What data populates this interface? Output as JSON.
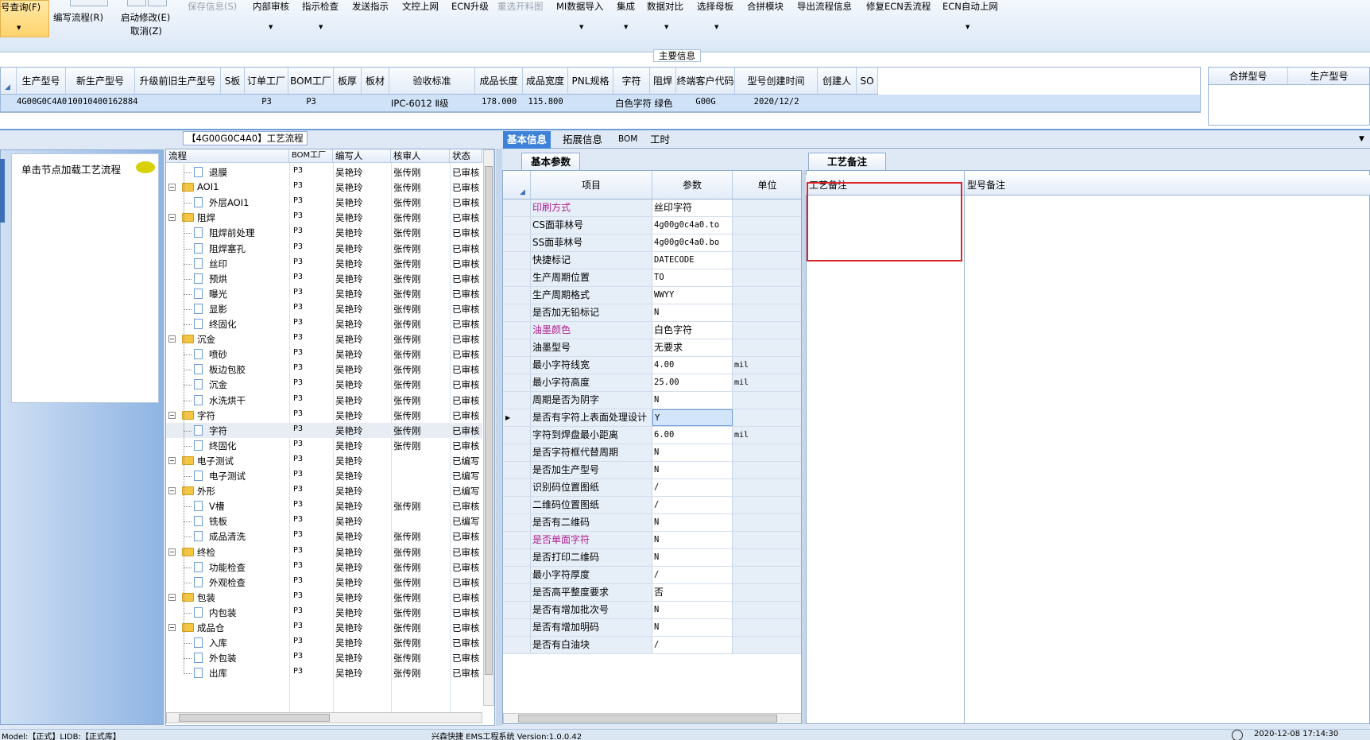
{
  "toolbar": {
    "query": "号查询(F)",
    "write_flow": "编写流程(R)",
    "start_modify": "启动修改(E)",
    "cancel": "取消(Z)",
    "save_info": "保存信息(S)",
    "internal_review": "内部审核",
    "guide_check": "指示检查",
    "send_guide": "发送指示",
    "doc_upload": "文控上网",
    "ecn_upgrade": "ECN升级",
    "resend_cut": "重选开料图",
    "mi_import": "MI数据导入",
    "integrate": "集成",
    "data_compare": "数据对比",
    "select_master": "选择母板",
    "merge_module": "合拼模块",
    "export_flow": "导出流程信息",
    "fix_ecn": "修复ECN丢流程",
    "ecn_auto": "ECN自动上网"
  },
  "main_info_label": "主要信息",
  "main_grid": {
    "headers": [
      "生产型号",
      "新生产型号",
      "升级前旧生产型号",
      "S板",
      "订单工厂",
      "BOM工厂",
      "板厚",
      "板材",
      "验收标准",
      "成品长度",
      "成品宽度",
      "PNL规格",
      "字符",
      "阻焊",
      "终端客户代码",
      "型号创建时间",
      "创建人",
      "SO"
    ],
    "row": [
      "4G00G0C4A0",
      "10010400162884",
      "",
      "",
      "P3",
      "P3",
      "",
      "",
      "IPC-6012 Ⅱ级",
      "178.000",
      "115.800",
      "",
      "白色字符",
      "绿色",
      "G00G",
      "2020/12/2",
      "",
      ""
    ]
  },
  "right_grid": {
    "headers": [
      "合拼型号",
      "生产型号"
    ]
  },
  "left_panel": {
    "load_hint": "单击节点加载工艺流程"
  },
  "tree_tab": "【4G00G0C4A0】工艺流程",
  "tree": {
    "headers": [
      "流程",
      "BOM工厂",
      "编写人",
      "核审人",
      "状态"
    ],
    "rows": [
      {
        "name": "退膜",
        "level": 2,
        "bom": "P3",
        "writer": "吴艳玲",
        "reviewer": "张传刚",
        "status": "已审核"
      },
      {
        "name": "AOI1",
        "level": 1,
        "bom": "P3",
        "writer": "吴艳玲",
        "reviewer": "张传刚",
        "status": "已审核"
      },
      {
        "name": "外层AOI1",
        "level": 2,
        "bom": "P3",
        "writer": "吴艳玲",
        "reviewer": "张传刚",
        "status": "已审核"
      },
      {
        "name": "阻焊",
        "level": 1,
        "bom": "P3",
        "writer": "吴艳玲",
        "reviewer": "张传刚",
        "status": "已审核"
      },
      {
        "name": "阻焊前处理",
        "level": 2,
        "bom": "P3",
        "writer": "吴艳玲",
        "reviewer": "张传刚",
        "status": "已审核"
      },
      {
        "name": "阻焊塞孔",
        "level": 2,
        "bom": "P3",
        "writer": "吴艳玲",
        "reviewer": "张传刚",
        "status": "已审核"
      },
      {
        "name": "丝印",
        "level": 2,
        "bom": "P3",
        "writer": "吴艳玲",
        "reviewer": "张传刚",
        "status": "已审核"
      },
      {
        "name": "预烘",
        "level": 2,
        "bom": "P3",
        "writer": "吴艳玲",
        "reviewer": "张传刚",
        "status": "已审核"
      },
      {
        "name": "曝光",
        "level": 2,
        "bom": "P3",
        "writer": "吴艳玲",
        "reviewer": "张传刚",
        "status": "已审核"
      },
      {
        "name": "显影",
        "level": 2,
        "bom": "P3",
        "writer": "吴艳玲",
        "reviewer": "张传刚",
        "status": "已审核"
      },
      {
        "name": "终固化",
        "level": 2,
        "bom": "P3",
        "writer": "吴艳玲",
        "reviewer": "张传刚",
        "status": "已审核"
      },
      {
        "name": "沉金",
        "level": 1,
        "bom": "P3",
        "writer": "吴艳玲",
        "reviewer": "张传刚",
        "status": "已审核"
      },
      {
        "name": "喷砂",
        "level": 2,
        "bom": "P3",
        "writer": "吴艳玲",
        "reviewer": "张传刚",
        "status": "已审核"
      },
      {
        "name": "板边包胶",
        "level": 2,
        "bom": "P3",
        "writer": "吴艳玲",
        "reviewer": "张传刚",
        "status": "已审核"
      },
      {
        "name": "沉金",
        "level": 2,
        "bom": "P3",
        "writer": "吴艳玲",
        "reviewer": "张传刚",
        "status": "已审核"
      },
      {
        "name": "水洗烘干",
        "level": 2,
        "bom": "P3",
        "writer": "吴艳玲",
        "reviewer": "张传刚",
        "status": "已审核"
      },
      {
        "name": "字符",
        "level": 1,
        "bom": "P3",
        "writer": "吴艳玲",
        "reviewer": "张传刚",
        "status": "已审核"
      },
      {
        "name": "字符",
        "level": 2,
        "bom": "P3",
        "writer": "吴艳玲",
        "reviewer": "张传刚",
        "status": "已审核",
        "selected": true
      },
      {
        "name": "终固化",
        "level": 2,
        "bom": "P3",
        "writer": "吴艳玲",
        "reviewer": "张传刚",
        "status": "已审核"
      },
      {
        "name": "电子测试",
        "level": 1,
        "bom": "P3",
        "writer": "吴艳玲",
        "reviewer": "",
        "status": "已编写"
      },
      {
        "name": "电子测试",
        "level": 2,
        "bom": "P3",
        "writer": "吴艳玲",
        "reviewer": "",
        "status": "已编写"
      },
      {
        "name": "外形",
        "level": 1,
        "bom": "P3",
        "writer": "吴艳玲",
        "reviewer": "",
        "status": "已编写"
      },
      {
        "name": "V槽",
        "level": 2,
        "bom": "P3",
        "writer": "吴艳玲",
        "reviewer": "张传刚",
        "status": "已审核"
      },
      {
        "name": "铣板",
        "level": 2,
        "bom": "P3",
        "writer": "吴艳玲",
        "reviewer": "",
        "status": "已编写"
      },
      {
        "name": "成品清洗",
        "level": 2,
        "bom": "P3",
        "writer": "吴艳玲",
        "reviewer": "张传刚",
        "status": "已审核"
      },
      {
        "name": "终检",
        "level": 1,
        "bom": "P3",
        "writer": "吴艳玲",
        "reviewer": "张传刚",
        "status": "已审核"
      },
      {
        "name": "功能检查",
        "level": 2,
        "bom": "P3",
        "writer": "吴艳玲",
        "reviewer": "张传刚",
        "status": "已审核"
      },
      {
        "name": "外观检查",
        "level": 2,
        "bom": "P3",
        "writer": "吴艳玲",
        "reviewer": "张传刚",
        "status": "已审核"
      },
      {
        "name": "包装",
        "level": 1,
        "bom": "P3",
        "writer": "吴艳玲",
        "reviewer": "张传刚",
        "status": "已审核"
      },
      {
        "name": "内包装",
        "level": 2,
        "bom": "P3",
        "writer": "吴艳玲",
        "reviewer": "张传刚",
        "status": "已审核"
      },
      {
        "name": "成品仓",
        "level": 1,
        "bom": "P3",
        "writer": "吴艳玲",
        "reviewer": "张传刚",
        "status": "已审核"
      },
      {
        "name": "入库",
        "level": 2,
        "bom": "P3",
        "writer": "吴艳玲",
        "reviewer": "张传刚",
        "status": "已审核"
      },
      {
        "name": "外包装",
        "level": 2,
        "bom": "P3",
        "writer": "吴艳玲",
        "reviewer": "张传刚",
        "status": "已审核"
      },
      {
        "name": "出库",
        "level": 2,
        "bom": "P3",
        "writer": "吴艳玲",
        "reviewer": "张传刚",
        "status": "已审核"
      }
    ]
  },
  "mid_tabs": [
    "基本信息",
    "拓展信息",
    "BOM",
    "工时"
  ],
  "param_tab": "基本参数",
  "param_grid": {
    "headers": [
      "项目",
      "参数",
      "单位"
    ],
    "rows": [
      {
        "item": "印刷方式",
        "value": "丝印字符",
        "unit": "",
        "mag": true,
        "cn": true
      },
      {
        "item": "CS面菲林号",
        "value": "4g00g0c4a0.to",
        "unit": ""
      },
      {
        "item": "SS面菲林号",
        "value": "4g00g0c4a0.bo",
        "unit": ""
      },
      {
        "item": "快捷标记",
        "value": "DATECODE",
        "unit": ""
      },
      {
        "item": "生产周期位置",
        "value": "TO",
        "unit": ""
      },
      {
        "item": "生产周期格式",
        "value": "WWYY",
        "unit": ""
      },
      {
        "item": "是否加无铅标记",
        "value": "N",
        "unit": ""
      },
      {
        "item": "油墨颜色",
        "value": "白色字符",
        "unit": "",
        "mag": true,
        "cn": true
      },
      {
        "item": "油墨型号",
        "value": "无要求",
        "unit": "",
        "cn": true
      },
      {
        "item": "最小字符线宽",
        "value": "4.00",
        "unit": "mil"
      },
      {
        "item": "最小字符高度",
        "value": "25.00",
        "unit": "mil"
      },
      {
        "item": "周期是否为阴字",
        "value": "N",
        "unit": ""
      },
      {
        "item": "是否有字符上表面处理设计",
        "value": "Y",
        "unit": "",
        "current": true
      },
      {
        "item": "字符到焊盘最小距离",
        "value": "6.00",
        "unit": "mil"
      },
      {
        "item": "是否字符框代替周期",
        "value": "N",
        "unit": ""
      },
      {
        "item": "是否加生产型号",
        "value": "N",
        "unit": ""
      },
      {
        "item": "识别码位置图纸",
        "value": "/",
        "unit": ""
      },
      {
        "item": "二维码位置图纸",
        "value": "/",
        "unit": ""
      },
      {
        "item": "是否有二维码",
        "value": "N",
        "unit": ""
      },
      {
        "item": "是否单面字符",
        "value": "N",
        "unit": "",
        "mag": true
      },
      {
        "item": "是否打印二维码",
        "value": "N",
        "unit": ""
      },
      {
        "item": "最小字符厚度",
        "value": "/",
        "unit": ""
      },
      {
        "item": "是否高平整度要求",
        "value": "否",
        "unit": "",
        "cn": true
      },
      {
        "item": "是否有增加批次号",
        "value": "N",
        "unit": ""
      },
      {
        "item": "是否有增加明码",
        "value": "N",
        "unit": ""
      },
      {
        "item": "是否有白油块",
        "value": "/",
        "unit": ""
      }
    ]
  },
  "remark": {
    "tab": "工艺备注",
    "col1": "工艺备注",
    "col2": "型号备注"
  },
  "statusbar": {
    "left": "Model:【正式】LIDB:【正式库】",
    "center": "兴森快捷 EMS工程系统 Version:1.0.0.42",
    "right": "2020-12-08 17:14:30"
  },
  "colors": {
    "accent": "#3d82d8",
    "highlight_red": "#d9262a",
    "magenta_label": "#b0208e"
  }
}
